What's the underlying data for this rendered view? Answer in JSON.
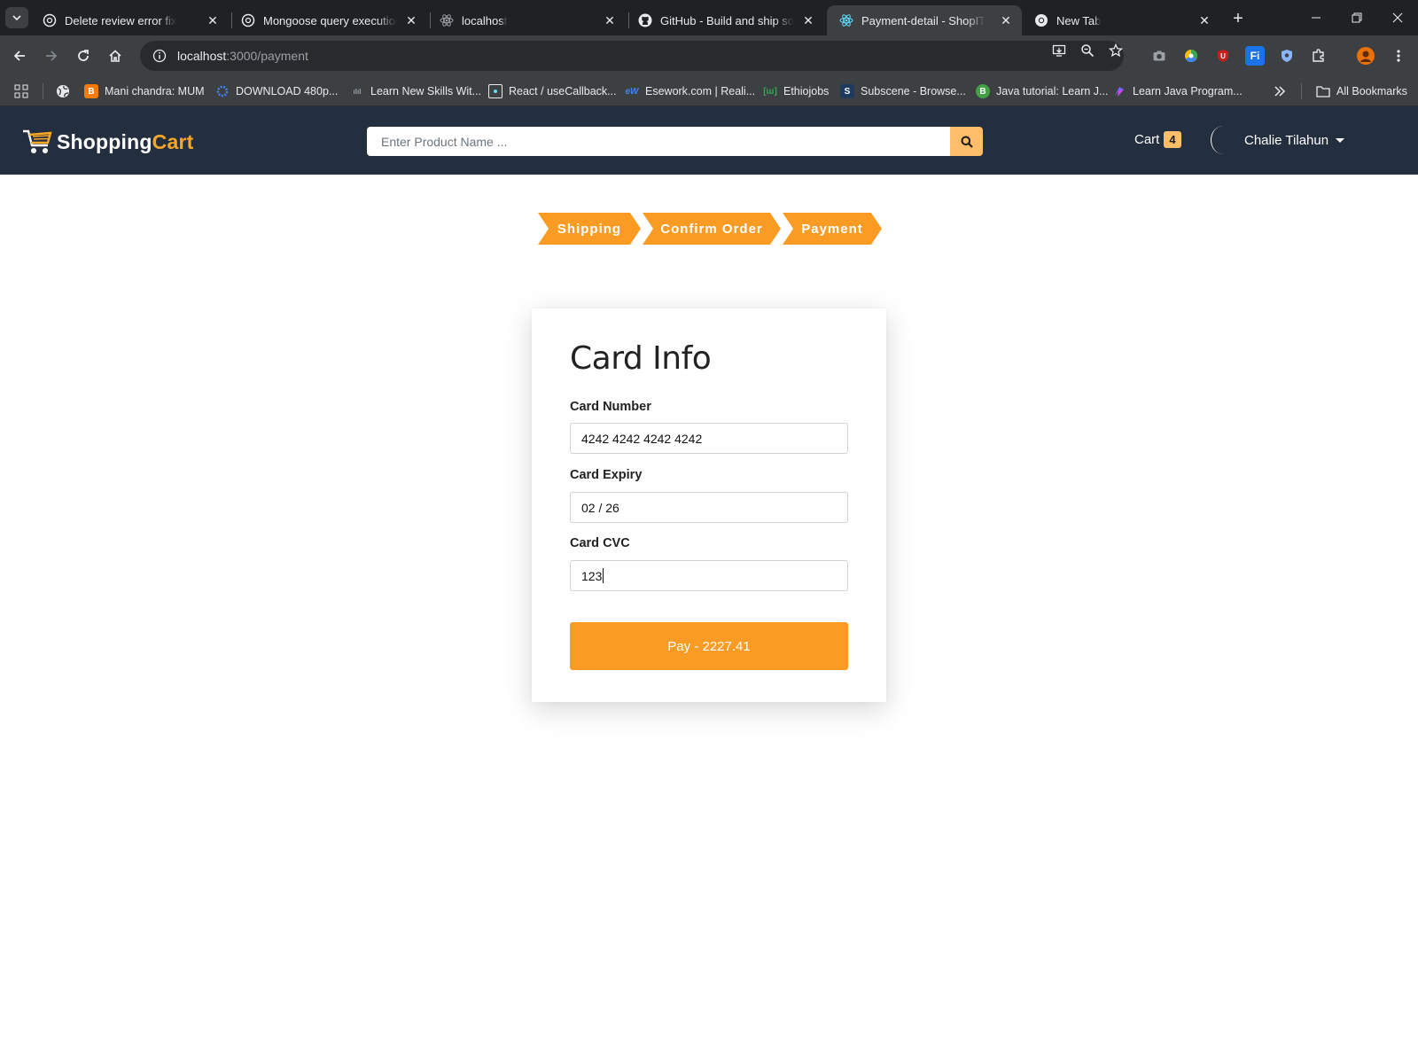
{
  "browser": {
    "tabs": [
      {
        "title": "Delete review error fix",
        "icon": "openai-icon",
        "active": false
      },
      {
        "title": "Mongoose query execution error",
        "icon": "openai-icon",
        "active": false
      },
      {
        "title": "localhost",
        "icon": "react-icon",
        "active": false
      },
      {
        "title": "GitHub - Build and ship software",
        "icon": "github-icon",
        "active": false
      },
      {
        "title": "Payment-detail - ShopIT",
        "icon": "react-icon",
        "active": true
      },
      {
        "title": "New Tab",
        "icon": "chrome-icon",
        "active": false
      }
    ],
    "address": {
      "host": "localhost",
      "path": ":3000/payment"
    },
    "bookmarks": [
      {
        "label": "Mani chandra: MUM",
        "icon": "blogger-icon",
        "color": "#f57c00"
      },
      {
        "label": "DOWNLOAD 480p...",
        "icon": "gear-bookmark-icon",
        "color": "#3c4043"
      },
      {
        "label": "Learn New Skills Wit...",
        "icon": "cisco-icon",
        "color": "#3c4043"
      },
      {
        "label": "React / useCallback...",
        "icon": "react-doc-icon",
        "color": "#3c4043"
      },
      {
        "label": "Esework.com | Reali...",
        "icon": "esework-icon",
        "color": "#3c4043"
      },
      {
        "label": "Ethiojobs",
        "icon": "ethiojobs-icon",
        "color": "#3c4043"
      },
      {
        "label": "Subscene - Browse...",
        "icon": "subscene-icon",
        "color": "#1e3a5f"
      },
      {
        "label": "Java tutorial: Learn J...",
        "icon": "java-icon",
        "color": "#43a047"
      },
      {
        "label": "Learn Java Program...",
        "icon": "programiz-icon",
        "color": "#3c4043"
      }
    ],
    "all_bookmarks_label": "All Bookmarks"
  },
  "header": {
    "logo_shop": "Shopping",
    "logo_cart": "Cart",
    "search_placeholder": "Enter Product Name ...",
    "cart_label": "Cart",
    "cart_count": "4",
    "user_name": "Chalie Tilahun"
  },
  "steps": [
    "Shipping",
    "Confirm Order",
    "Payment"
  ],
  "card": {
    "title": "Card Info",
    "number_label": "Card Number",
    "number_value": "4242 4242 4242 4242",
    "expiry_label": "Card Expiry",
    "expiry_value": "02 / 26",
    "cvc_label": "Card CVC",
    "cvc_value": "123",
    "pay_label": "Pay - 2227.41"
  },
  "colors": {
    "accent": "#fa9c23",
    "header_bg": "#232f3e",
    "badge": "#febd69"
  }
}
